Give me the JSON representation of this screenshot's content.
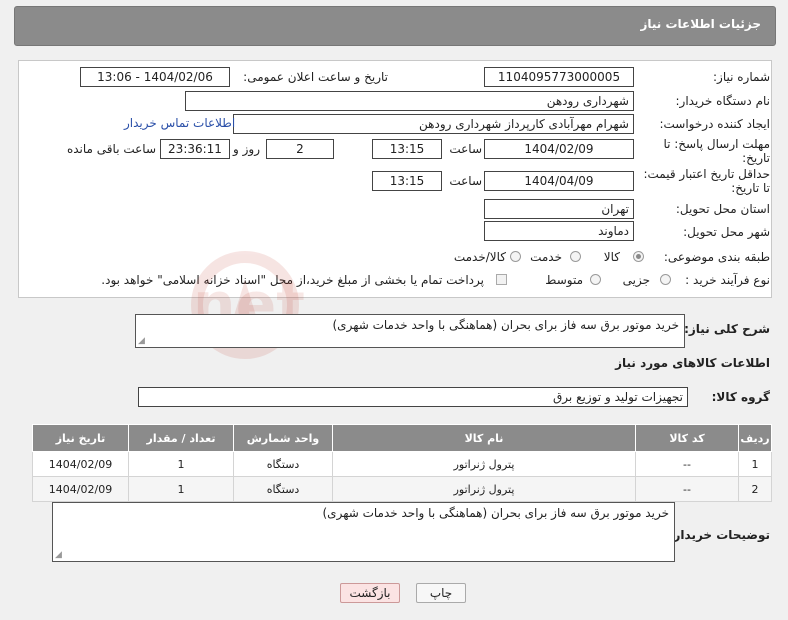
{
  "header": {
    "title": "جزئیات اطلاعات نیاز"
  },
  "form": {
    "need_number_label": "شماره نیاز:",
    "need_number": "1104095773000005",
    "announce_label": "تاریخ و ساعت اعلان عمومی:",
    "announce_value": "1404/02/06 - 13:06",
    "buyer_org_label": "نام دستگاه خریدار:",
    "buyer_org": "شهرداری رودهن",
    "requester_label": "ایجاد کننده درخواست:",
    "requester": "شهرام مهرآبادی کارپرداز شهرداری رودهن",
    "contact_link": "اطلاعات تماس خریدار",
    "deadline_label_1": "مهلت ارسال پاسخ: تا",
    "deadline_label_2": "تاریخ:",
    "deadline_date": "1404/02/09",
    "time_label": "ساعت",
    "deadline_time": "13:15",
    "days_value": "2",
    "days_label": "روز و",
    "remaining_time": "23:36:11",
    "remaining_label": "ساعت باقی مانده",
    "validity_label_1": "حداقل تاریخ اعتبار قیمت:",
    "validity_label_2": "تا تاریخ:",
    "validity_date": "1404/04/09",
    "validity_time": "13:15",
    "province_label": "استان محل تحویل:",
    "province": "تهران",
    "city_label": "شهر محل تحویل:",
    "city": "دماوند",
    "category_label": "طبقه بندی موضوعی:",
    "category_options": [
      "کالا",
      "خدمت",
      "کالا/خدمت"
    ],
    "process_label": "نوع فرآیند خرید :",
    "process_options": [
      "جزیی",
      "متوسط"
    ],
    "payment_note": "پرداخت تمام یا بخشی از مبلغ خرید،از محل \"اسناد خزانه اسلامی\" خواهد بود."
  },
  "description": {
    "label": "شرح کلی نیاز:",
    "text": "خرید موتور برق سه فاز برای بحران (هماهنگی با واحد خدمات شهری)"
  },
  "goods": {
    "section_title": "اطلاعات کالاهای مورد نیاز",
    "group_label": "گروه کالا:",
    "group_value": "تجهیزات تولید و توزیع برق",
    "columns": [
      "ردیف",
      "کد کالا",
      "نام کالا",
      "واحد شمارش",
      "تعداد / مقدار",
      "تاریخ نیاز"
    ],
    "rows": [
      [
        "1",
        "--",
        "پترول ژنراتور",
        "دستگاه",
        "1",
        "1404/02/09"
      ],
      [
        "2",
        "--",
        "پترول ژنراتور",
        "دستگاه",
        "1",
        "1404/02/09"
      ]
    ]
  },
  "buyer_notes": {
    "label": "توضیحات خریدار:",
    "text": "خرید موتور برق سه فاز برای بحران (هماهنگی با واحد خدمات شهری)"
  },
  "buttons": {
    "print": "چاپ",
    "back": "بازگشت"
  },
  "watermark": {
    "text": "AriaTender.net"
  },
  "colors": {
    "header_bg": "#8b8b8b",
    "link": "#2a4fa8",
    "back_button_bg": "#fbe3e3"
  }
}
